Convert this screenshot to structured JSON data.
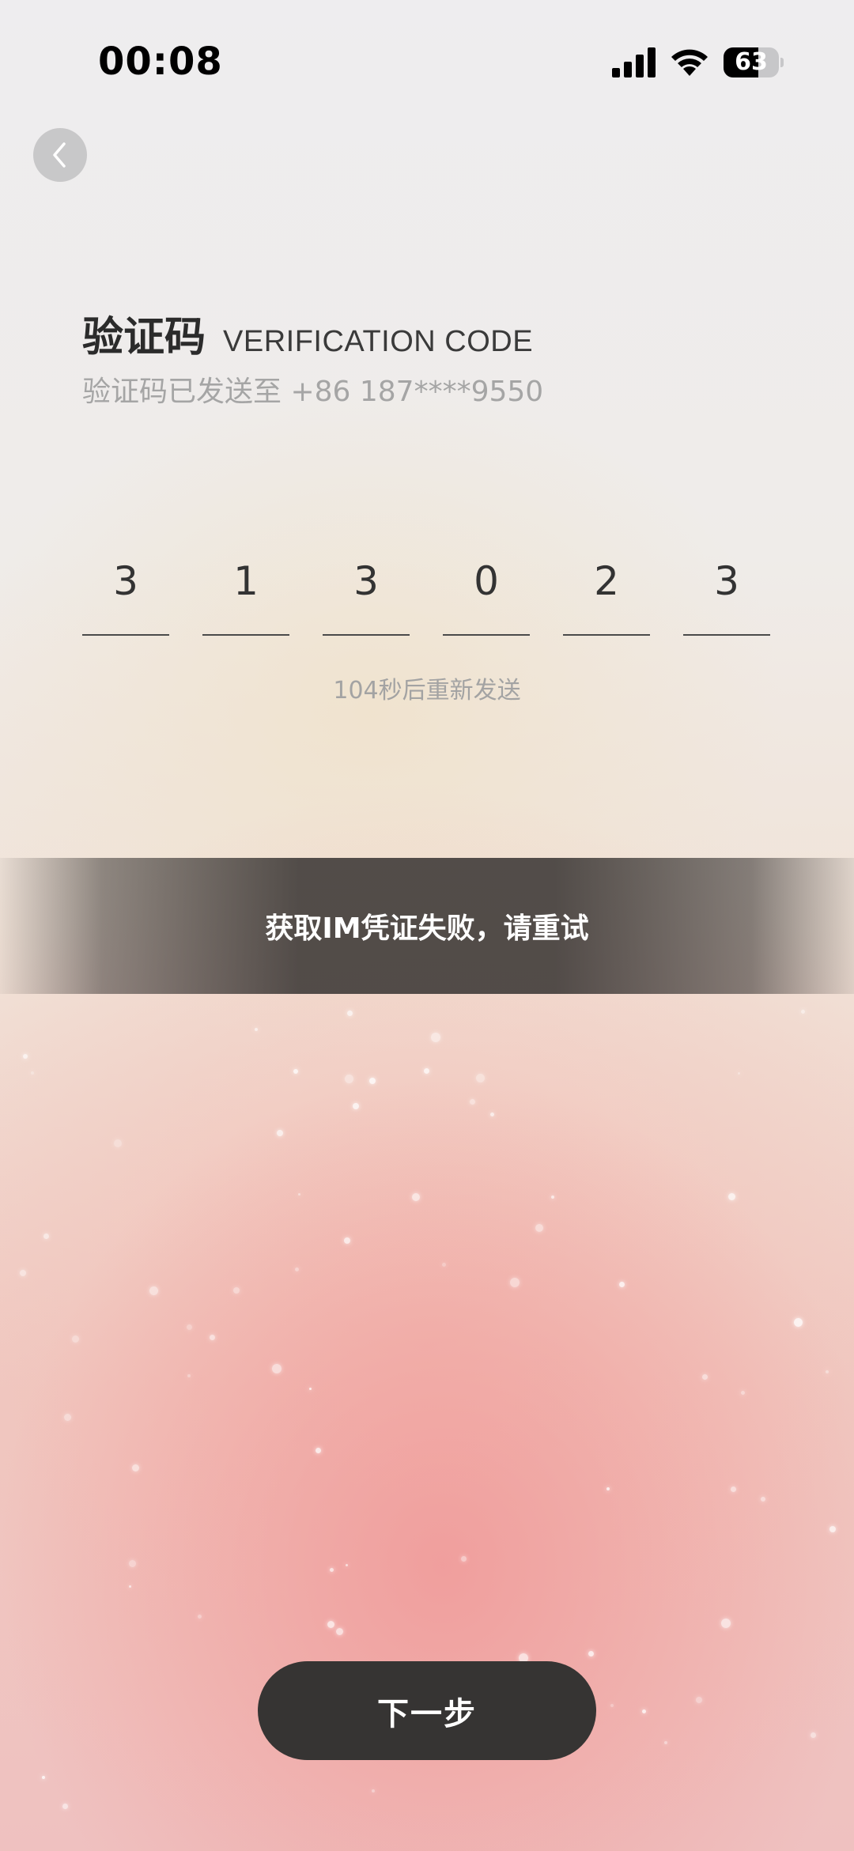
{
  "status_bar": {
    "time": "00:08",
    "battery_level": "63",
    "battery_fraction": 0.63
  },
  "header": {
    "title_cn": "验证码",
    "title_en": "VERIFICATION CODE",
    "subtitle": "验证码已发送至 +86 187****9550"
  },
  "code": {
    "digits": [
      "3",
      "1",
      "3",
      "0",
      "2",
      "3"
    ]
  },
  "countdown": "104秒后重新发送",
  "toast": "获取IM凭证失败，请重试",
  "next_button": "下一步",
  "icons": {
    "back": "chevron-left-icon",
    "signal": "cellular-signal-icon",
    "wifi": "wifi-icon",
    "battery": "battery-icon"
  },
  "colors": {
    "primary_button": "#363433",
    "text_dark": "#2b2b2b",
    "text_muted": "#a5a5a5",
    "toast_bg": "#3c3836"
  }
}
